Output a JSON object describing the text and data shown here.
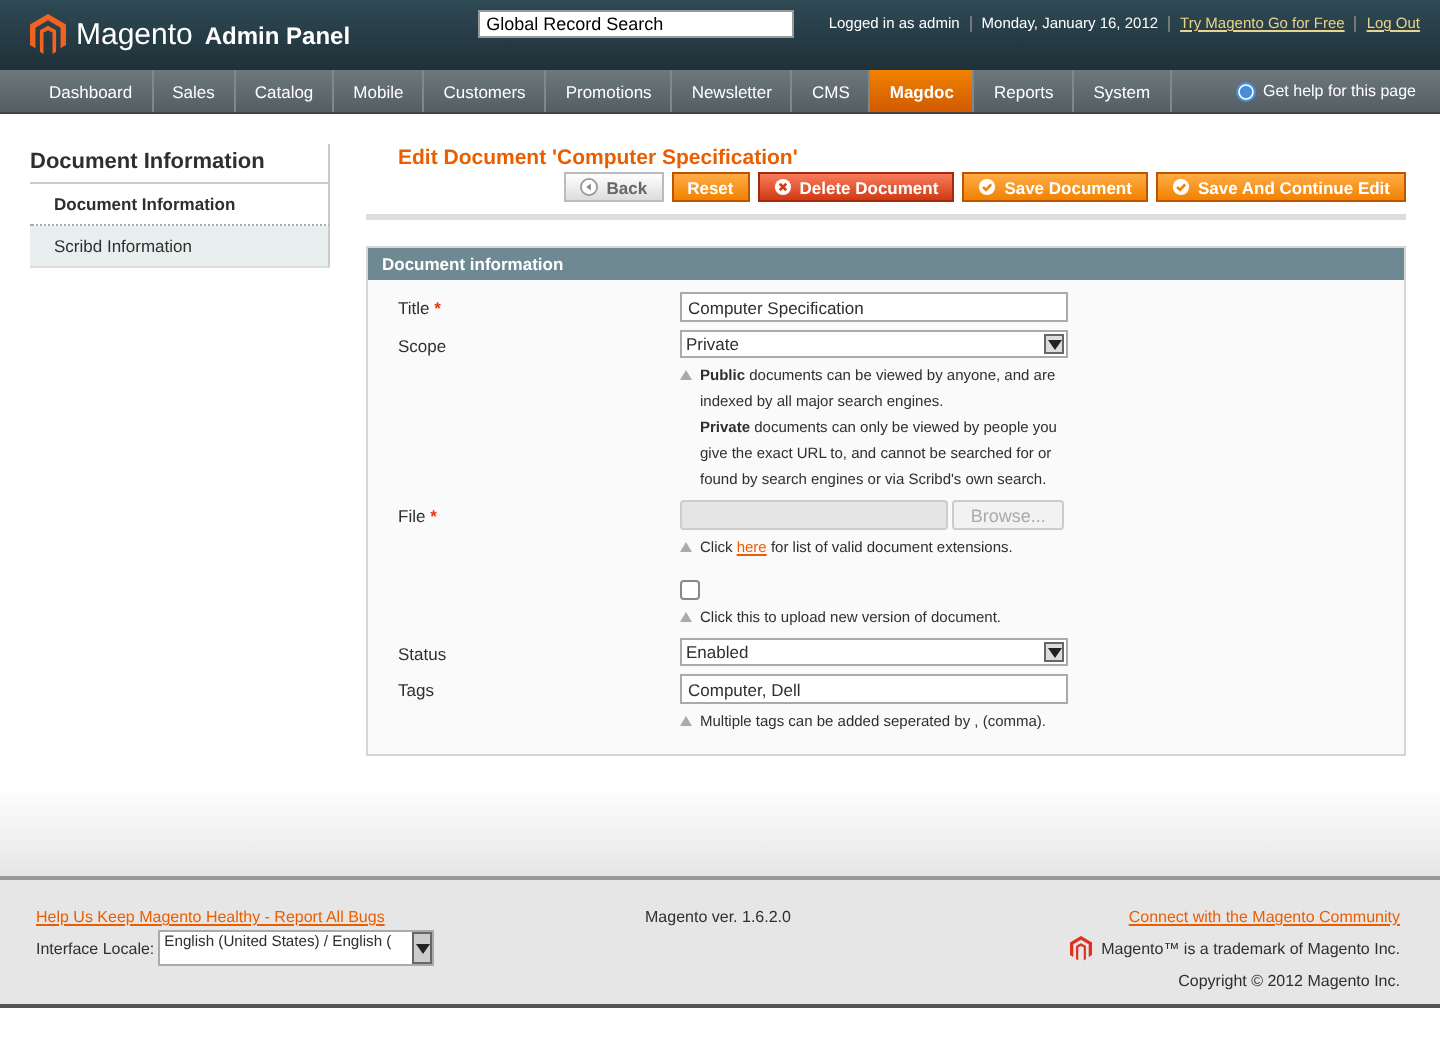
{
  "header": {
    "logo": "Magento",
    "logo_suffix": "Admin Panel",
    "search": {
      "value": "Global Record Search"
    },
    "user_info": "Logged in as admin",
    "date": "Monday, January 16, 2012",
    "links": [
      "Try Magento Go for Free",
      "Log Out"
    ]
  },
  "nav": {
    "items": [
      {
        "label": "Dashboard",
        "selected": false
      },
      {
        "label": "Sales",
        "selected": false
      },
      {
        "label": "Catalog",
        "selected": false
      },
      {
        "label": "Mobile",
        "selected": false
      },
      {
        "label": "Customers",
        "selected": false
      },
      {
        "label": "Promotions",
        "selected": false
      },
      {
        "label": "Newsletter",
        "selected": false
      },
      {
        "label": "CMS",
        "selected": false
      },
      {
        "label": "Magdoc",
        "selected": true
      },
      {
        "label": "Reports",
        "selected": false
      },
      {
        "label": "System",
        "selected": false
      }
    ],
    "help": "Get help for this page"
  },
  "sidebar": {
    "title": "Document Information",
    "items": [
      {
        "label": "Document Information",
        "selected": true
      },
      {
        "label": "Scribd Information",
        "selected": false
      }
    ]
  },
  "page_title": "Edit Document 'Computer Specification'",
  "buttons": [
    {
      "label": "Back",
      "kind": "back"
    },
    {
      "label": "Reset",
      "kind": "plain"
    },
    {
      "label": "Delete Document",
      "kind": "delete"
    },
    {
      "label": "Save Document",
      "kind": "save"
    },
    {
      "label": "Save And Continue Edit",
      "kind": "save"
    }
  ],
  "section": {
    "title": "Document information",
    "fields": [
      {
        "kind": "text",
        "label": "Title",
        "required_mark": "*",
        "value": "Computer Specification"
      },
      {
        "kind": "select",
        "label": "Scope",
        "value": "Private",
        "notes": [
          "**Public** documents can be viewed by anyone, and are indexed by all major search engines.",
          "**Private** documents can only be viewed by people you give the exact URL to, and cannot be searched for or found by search engines or via Scribd's own search."
        ]
      },
      {
        "kind": "file",
        "label": "File",
        "required_mark": "*",
        "browse": "Browse...",
        "note_before": "Click",
        "note_link": "here",
        "note_after": "for list of valid document extensions."
      },
      {
        "kind": "checkbox",
        "checked": false,
        "note": "Click this to upload new version of document."
      },
      {
        "kind": "select",
        "label": "Status",
        "value": "Enabled"
      },
      {
        "kind": "text",
        "label": "Tags",
        "value": "Computer, Dell",
        "note": "Multiple tags can be added seperated by , (comma)."
      }
    ]
  },
  "footer": {
    "bug_link": "Help Us Keep Magento Healthy - Report All Bugs",
    "locale_label": "Interface Locale:",
    "locale_value": "English (United States) / English (",
    "version": "Magento ver. 1.6.2.0",
    "community_link": "Connect with the Magento Community",
    "trademark": "Magento™ is a trademark of Magento Inc.",
    "copyright": "Copyright © 2012 Magento Inc."
  }
}
